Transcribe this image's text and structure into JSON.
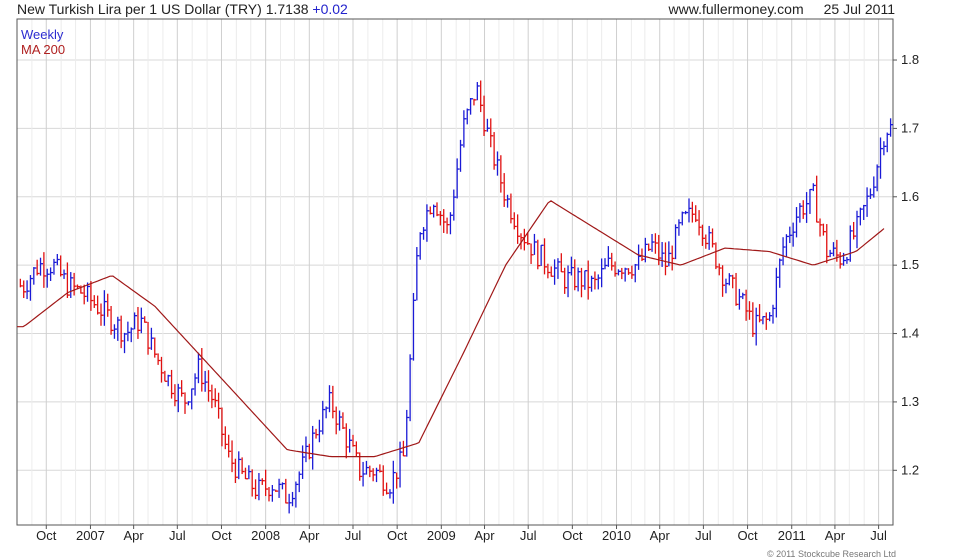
{
  "header": {
    "title": "New Turkish Lira per 1 US Dollar (TRY)",
    "last": "1.7138",
    "change": "+0.02",
    "source": "www.fullermoney.com",
    "date": "25 Jul 2011"
  },
  "legend": {
    "weekly": "Weekly",
    "ma": "MA 200"
  },
  "copyright": "© 2011 Stockcube Research Ltd",
  "colors": {
    "up": "#1a1ad6",
    "down": "#e01010",
    "ma": "#a01818",
    "grid": "#d8d8d8",
    "axis": "#555555"
  },
  "chart_data": {
    "type": "line",
    "title": "New Turkish Lira per 1 US Dollar (TRY)",
    "xlabel": "",
    "ylabel": "",
    "ylim": [
      1.12,
      1.86
    ],
    "y_ticks": [
      1.2,
      1.3,
      1.4,
      1.5,
      1.6,
      1.7,
      1.8
    ],
    "y_tick_labels": [
      "1.2",
      "1.3",
      "1.4",
      "1.5",
      "1.6",
      "1.7",
      "1.8"
    ],
    "x_ticks": [
      "Oct",
      "2007",
      "Apr",
      "Jul",
      "Oct",
      "2008",
      "Apr",
      "Jul",
      "Oct",
      "2009",
      "Apr",
      "Jul",
      "Oct",
      "2010",
      "Apr",
      "Jul",
      "Oct",
      "2011",
      "Apr",
      "Jul"
    ],
    "grid": true,
    "legend_position": "top-left",
    "series": [
      {
        "name": "Weekly",
        "style": "weekly price bars",
        "x": [
          "2006-08",
          "2006-09",
          "2006-10",
          "2006-11",
          "2006-12",
          "2007-01",
          "2007-02",
          "2007-03",
          "2007-04",
          "2007-05",
          "2007-06",
          "2007-07",
          "2007-08",
          "2007-09",
          "2007-10",
          "2007-11",
          "2007-12",
          "2008-01",
          "2008-02",
          "2008-03",
          "2008-04",
          "2008-05",
          "2008-06",
          "2008-07",
          "2008-08",
          "2008-09",
          "2008-10",
          "2008-11",
          "2008-12",
          "2009-01",
          "2009-02",
          "2009-03",
          "2009-04",
          "2009-05",
          "2009-06",
          "2009-07",
          "2009-08",
          "2009-09",
          "2009-10",
          "2009-11",
          "2009-12",
          "2010-01",
          "2010-02",
          "2010-03",
          "2010-04",
          "2010-05",
          "2010-06",
          "2010-07",
          "2010-08",
          "2010-09",
          "2010-10",
          "2010-11",
          "2010-12",
          "2011-01",
          "2011-02",
          "2011-03",
          "2011-04",
          "2011-05",
          "2011-06",
          "2011-07"
        ],
        "values": [
          1.47,
          1.5,
          1.5,
          1.47,
          1.46,
          1.44,
          1.42,
          1.4,
          1.42,
          1.37,
          1.33,
          1.3,
          1.35,
          1.3,
          1.22,
          1.19,
          1.17,
          1.18,
          1.16,
          1.2,
          1.26,
          1.3,
          1.25,
          1.2,
          1.2,
          1.18,
          1.22,
          1.55,
          1.6,
          1.55,
          1.7,
          1.76,
          1.67,
          1.6,
          1.55,
          1.52,
          1.5,
          1.48,
          1.48,
          1.47,
          1.5,
          1.5,
          1.5,
          1.53,
          1.5,
          1.56,
          1.58,
          1.53,
          1.48,
          1.45,
          1.41,
          1.42,
          1.53,
          1.58,
          1.6,
          1.52,
          1.51,
          1.55,
          1.61,
          1.7
        ]
      },
      {
        "name": "MA 200",
        "style": "line",
        "x": [
          "2006-08",
          "2006-11",
          "2007-02",
          "2007-05",
          "2007-08",
          "2007-11",
          "2008-02",
          "2008-05",
          "2008-08",
          "2008-11",
          "2009-02",
          "2009-05",
          "2009-08",
          "2009-11",
          "2010-02",
          "2010-05",
          "2010-08",
          "2010-11",
          "2011-02",
          "2011-05",
          "2011-07"
        ],
        "values": [
          1.41,
          1.46,
          1.485,
          1.44,
          1.37,
          1.3,
          1.23,
          1.22,
          1.22,
          1.24,
          1.37,
          1.5,
          1.595,
          1.555,
          1.515,
          1.5,
          1.525,
          1.52,
          1.5,
          1.52,
          1.555
        ]
      }
    ]
  }
}
